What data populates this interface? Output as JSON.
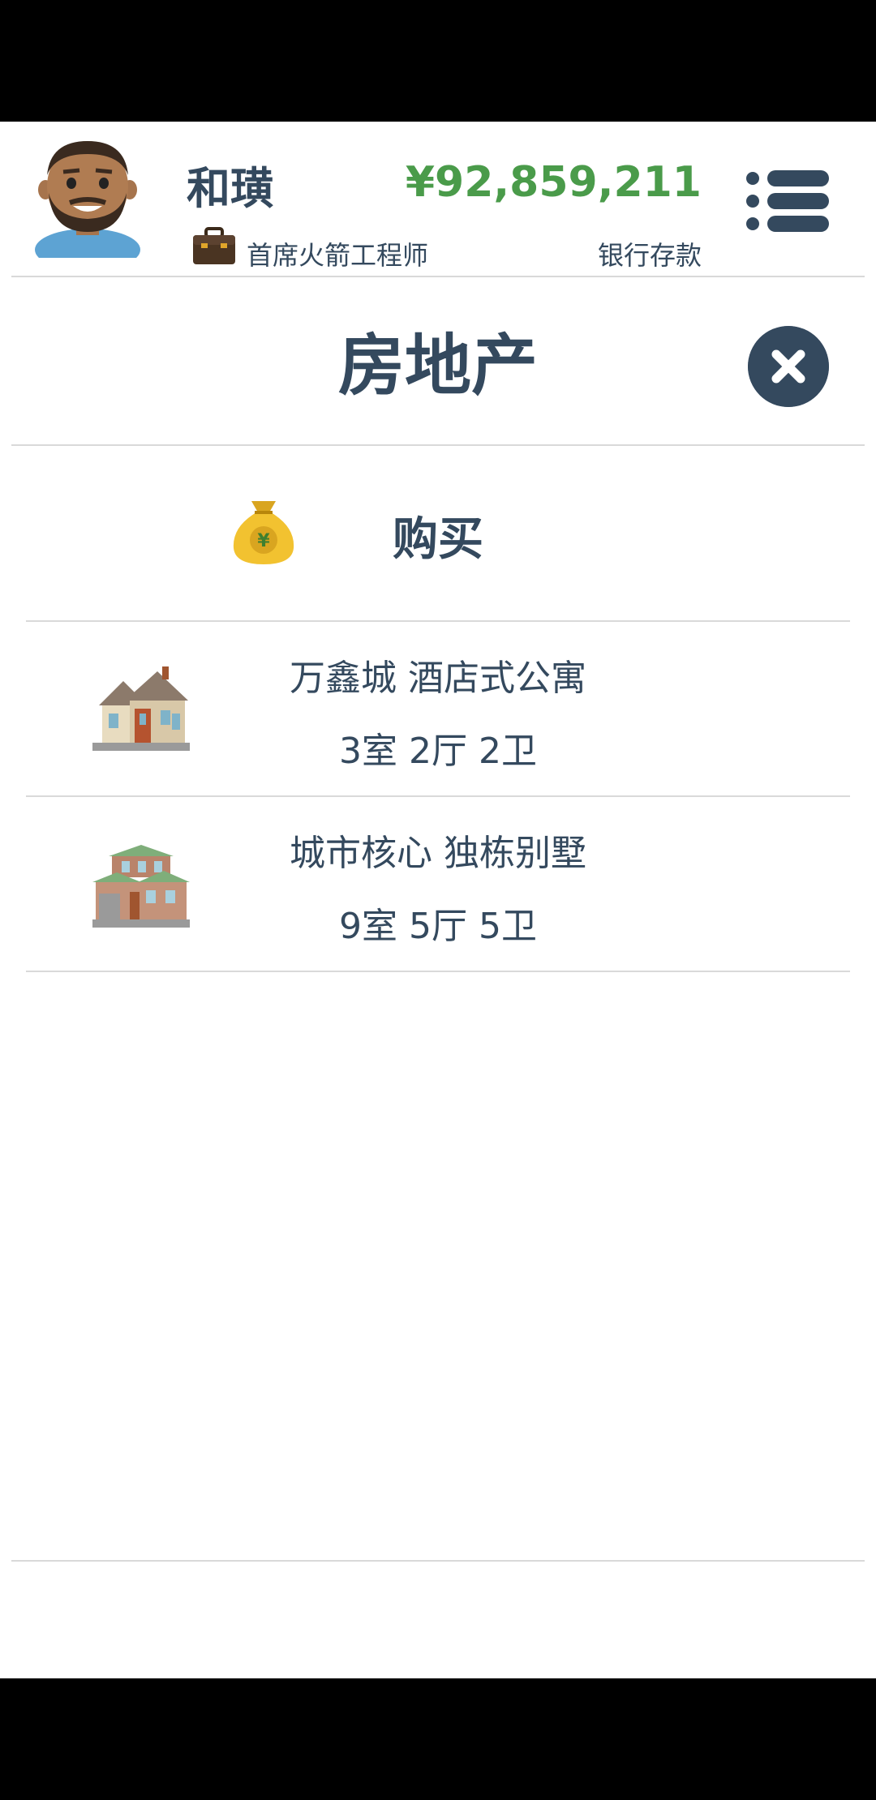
{
  "header": {
    "player_name": "和璜",
    "job_title": "首席火箭工程师",
    "balance": "¥92,859,211",
    "balance_label": "银行存款"
  },
  "page": {
    "title": "房地产",
    "buy_label": "购买"
  },
  "properties": [
    {
      "name": "万鑫城 酒店式公寓",
      "rooms": "3室 2厅 2卫",
      "icon": "house-icon"
    },
    {
      "name": "城市核心 独栋别墅",
      "rooms": "9室 5厅 5卫",
      "icon": "villa-icon"
    }
  ],
  "colors": {
    "primary": "#34495e",
    "money": "#4a9b4a",
    "divider": "#d9d9d9"
  }
}
